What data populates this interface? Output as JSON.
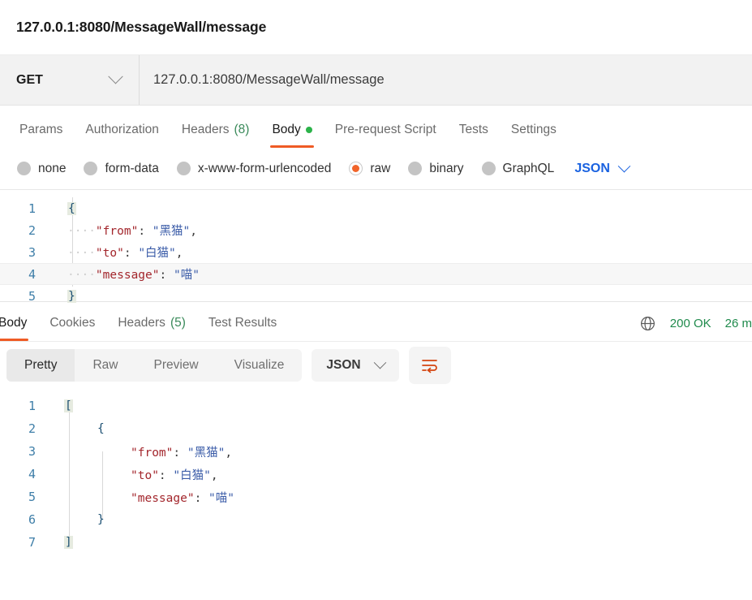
{
  "titlebar": {
    "text": "127.0.0.1:8080/MessageWall/message"
  },
  "request": {
    "method": "GET",
    "url": "127.0.0.1:8080/MessageWall/message",
    "tabs": [
      {
        "label": "Params",
        "active": false
      },
      {
        "label": "Authorization",
        "active": false
      },
      {
        "label": "Headers",
        "count": "(8)",
        "active": false
      },
      {
        "label": "Body",
        "active": true,
        "dot": true
      },
      {
        "label": "Pre-request Script",
        "active": false
      },
      {
        "label": "Tests",
        "active": false
      },
      {
        "label": "Settings",
        "active": false
      }
    ],
    "body_types": [
      {
        "label": "none",
        "selected": false
      },
      {
        "label": "form-data",
        "selected": false
      },
      {
        "label": "x-www-form-urlencoded",
        "selected": false
      },
      {
        "label": "raw",
        "selected": true
      },
      {
        "label": "binary",
        "selected": false
      },
      {
        "label": "GraphQL",
        "selected": false
      }
    ],
    "raw_format": "JSON",
    "body_lines": [
      {
        "n": "1",
        "indent": 0,
        "tokens": [
          {
            "t": "{",
            "c": "br-hl"
          }
        ],
        "highlight": false
      },
      {
        "n": "2",
        "indent": 1,
        "tokens": [
          {
            "t": "\"from\"",
            "c": "k"
          },
          {
            "t": ":",
            "c": "p"
          },
          {
            "t": " ",
            "c": "p"
          },
          {
            "t": "\"黑猫\"",
            "c": "s"
          },
          {
            "t": ",",
            "c": "p"
          }
        ],
        "highlight": false
      },
      {
        "n": "3",
        "indent": 1,
        "tokens": [
          {
            "t": "\"to\"",
            "c": "k"
          },
          {
            "t": ":",
            "c": "p"
          },
          {
            "t": " ",
            "c": "p"
          },
          {
            "t": "\"白猫\"",
            "c": "s"
          },
          {
            "t": ",",
            "c": "p"
          }
        ],
        "highlight": false
      },
      {
        "n": "4",
        "indent": 1,
        "tokens": [
          {
            "t": "\"message\"",
            "c": "k"
          },
          {
            "t": ":",
            "c": "p"
          },
          {
            "t": " ",
            "c": "p"
          },
          {
            "t": "\"喵\"",
            "c": "s"
          }
        ],
        "highlight": true
      },
      {
        "n": "5",
        "indent": 0,
        "tokens": [
          {
            "t": "}",
            "c": "br-hl"
          }
        ],
        "highlight": false
      }
    ]
  },
  "response": {
    "tabs": [
      {
        "label": "Body",
        "active": true
      },
      {
        "label": "Cookies",
        "active": false
      },
      {
        "label": "Headers",
        "count": "(5)",
        "active": false
      },
      {
        "label": "Test Results",
        "active": false
      }
    ],
    "status": "200 OK",
    "time": "26 m",
    "view_modes": [
      {
        "label": "Pretty",
        "active": true
      },
      {
        "label": "Raw",
        "active": false
      },
      {
        "label": "Preview",
        "active": false
      },
      {
        "label": "Visualize",
        "active": false
      }
    ],
    "format": "JSON",
    "body_lines": [
      {
        "n": "1",
        "indent": 0,
        "tokens": [
          {
            "t": "[",
            "c": "br-hl"
          }
        ]
      },
      {
        "n": "2",
        "indent": 1,
        "tokens": [
          {
            "t": "{",
            "c": "br"
          }
        ]
      },
      {
        "n": "3",
        "indent": 2,
        "tokens": [
          {
            "t": "\"from\"",
            "c": "k"
          },
          {
            "t": ":",
            "c": "p"
          },
          {
            "t": " ",
            "c": "p"
          },
          {
            "t": "\"黑猫\"",
            "c": "s"
          },
          {
            "t": ",",
            "c": "p"
          }
        ]
      },
      {
        "n": "4",
        "indent": 2,
        "tokens": [
          {
            "t": "\"to\"",
            "c": "k"
          },
          {
            "t": ":",
            "c": "p"
          },
          {
            "t": " ",
            "c": "p"
          },
          {
            "t": "\"白猫\"",
            "c": "s"
          },
          {
            "t": ",",
            "c": "p"
          }
        ]
      },
      {
        "n": "5",
        "indent": 2,
        "tokens": [
          {
            "t": "\"message\"",
            "c": "k"
          },
          {
            "t": ":",
            "c": "p"
          },
          {
            "t": " ",
            "c": "p"
          },
          {
            "t": "\"喵\"",
            "c": "s"
          }
        ]
      },
      {
        "n": "6",
        "indent": 1,
        "tokens": [
          {
            "t": "}",
            "c": "br"
          }
        ]
      },
      {
        "n": "7",
        "indent": 0,
        "tokens": [
          {
            "t": "]",
            "c": "br-hl"
          }
        ]
      }
    ]
  },
  "colors": {
    "accent_orange": "#ef5b25",
    "radio_selected": "#f1642a",
    "status_green": "#1f8a4c",
    "json_blue": "#1a62e0",
    "key_red": "#a3262c",
    "string_blue": "#3b5ca8"
  }
}
